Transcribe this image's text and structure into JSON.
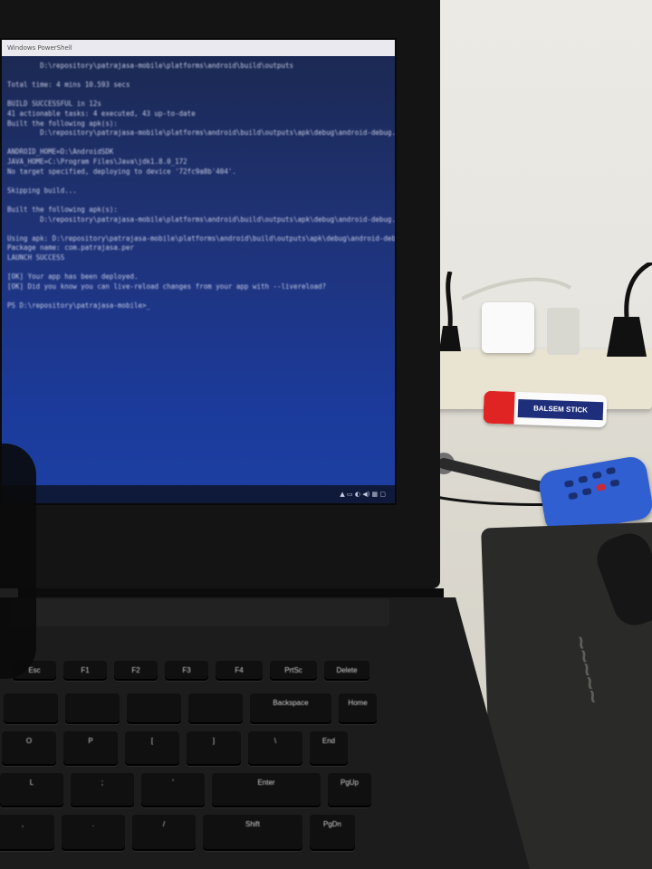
{
  "window": {
    "title": "Windows PowerShell"
  },
  "terminal_lines": [
    "        D:\\repository\\patrajasa-mobile\\platforms\\android\\build\\outputs",
    "",
    "Total time: 4 mins 10.593 secs",
    "",
    "BUILD SUCCESSFUL in 12s",
    "41 actionable tasks: 4 executed, 43 up-to-date",
    "Built the following apk(s):",
    "        D:\\repository\\patrajasa-mobile\\platforms\\android\\build\\outputs\\apk\\debug\\android-debug.apk",
    "",
    "ANDROID_HOME=D:\\AndroidSDK",
    "JAVA_HOME=C:\\Program Files\\Java\\jdk1.8.0_172",
    "No target specified, deploying to device '72fc9a8b'404'.",
    "",
    "Skipping build...",
    "",
    "Built the following apk(s):",
    "        D:\\repository\\patrajasa-mobile\\platforms\\android\\build\\outputs\\apk\\debug\\android-debug.apk",
    "",
    "Using apk: D:\\repository\\patrajasa-mobile\\platforms\\android\\build\\outputs\\apk\\debug\\android-debug.apk",
    "Package name: com.patrajasa.per",
    "LAUNCH SUCCESS",
    "",
    "[OK] Your app has been deployed.",
    "[OK] Did you know you can live-reload changes from your app with --livereload?",
    "",
    "PS D:\\repository\\patrajasa-mobile>_"
  ],
  "glue_stick": {
    "label": "BALSEM STICK"
  },
  "keyboard": {
    "rows": [
      [
        "Esc",
        "F1",
        "F2",
        "F3",
        "F4",
        "PrtSc",
        "Delete"
      ],
      [
        "",
        "",
        "",
        "",
        "Backspace",
        "Home"
      ],
      [
        "O",
        "P",
        "[",
        "]",
        "\\",
        "End"
      ],
      [
        "L",
        ";",
        "'",
        "Enter",
        "PgUp"
      ],
      [
        ",",
        ".",
        "/",
        "Shift",
        "PgDn"
      ]
    ]
  },
  "colors": {
    "screen_top": "#1b2850",
    "screen_bottom": "#1d40a3",
    "calculator": "#2f5fd0",
    "glue_cap": "#e02424"
  }
}
